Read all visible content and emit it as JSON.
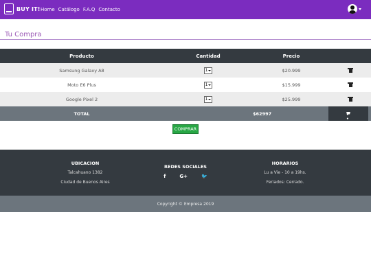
{
  "brand": {
    "name": "BUY IT!",
    "icon": "shopping-bag-icon"
  },
  "nav": {
    "links": [
      "Home",
      "Catálogo",
      "F.A.Q",
      "Contacto"
    ]
  },
  "user": {
    "icon": "user-avatar-icon"
  },
  "page": {
    "title": "Tu Compra"
  },
  "table": {
    "headers": [
      "Producto",
      "Cantidad",
      "Precio"
    ],
    "rows": [
      {
        "product": "Samsung Galaxy A8",
        "qty": "1",
        "price": "$20.999"
      },
      {
        "product": "Moto E6 Plus",
        "qty": "1",
        "price": "$15.999"
      },
      {
        "product": "Google Pixel 2",
        "qty": "1",
        "price": "$25.999"
      }
    ],
    "total_label": "TOTAL",
    "total_value": "$62997"
  },
  "buy_button": "COMPRAR",
  "footer": {
    "location": {
      "title": "UBICACION",
      "address": "Talcahuano 1382",
      "city": "Ciudad de Buenos Aires"
    },
    "social": {
      "title": "REDES SOCIALES",
      "icons": [
        "f",
        "G+",
        "🐦"
      ]
    },
    "hours": {
      "title": "HORARIOS",
      "weekdays": "Lu a Vie - 10 a 19hs.",
      "holidays": "Feriados: Cerrado."
    },
    "copyright": "Copyright © Empresa 2019"
  },
  "colors": {
    "navbar": "#7b2cbf",
    "dark": "#343a40",
    "gray": "#6c757d",
    "buy": "#28a745",
    "title": "#9b59b6"
  }
}
